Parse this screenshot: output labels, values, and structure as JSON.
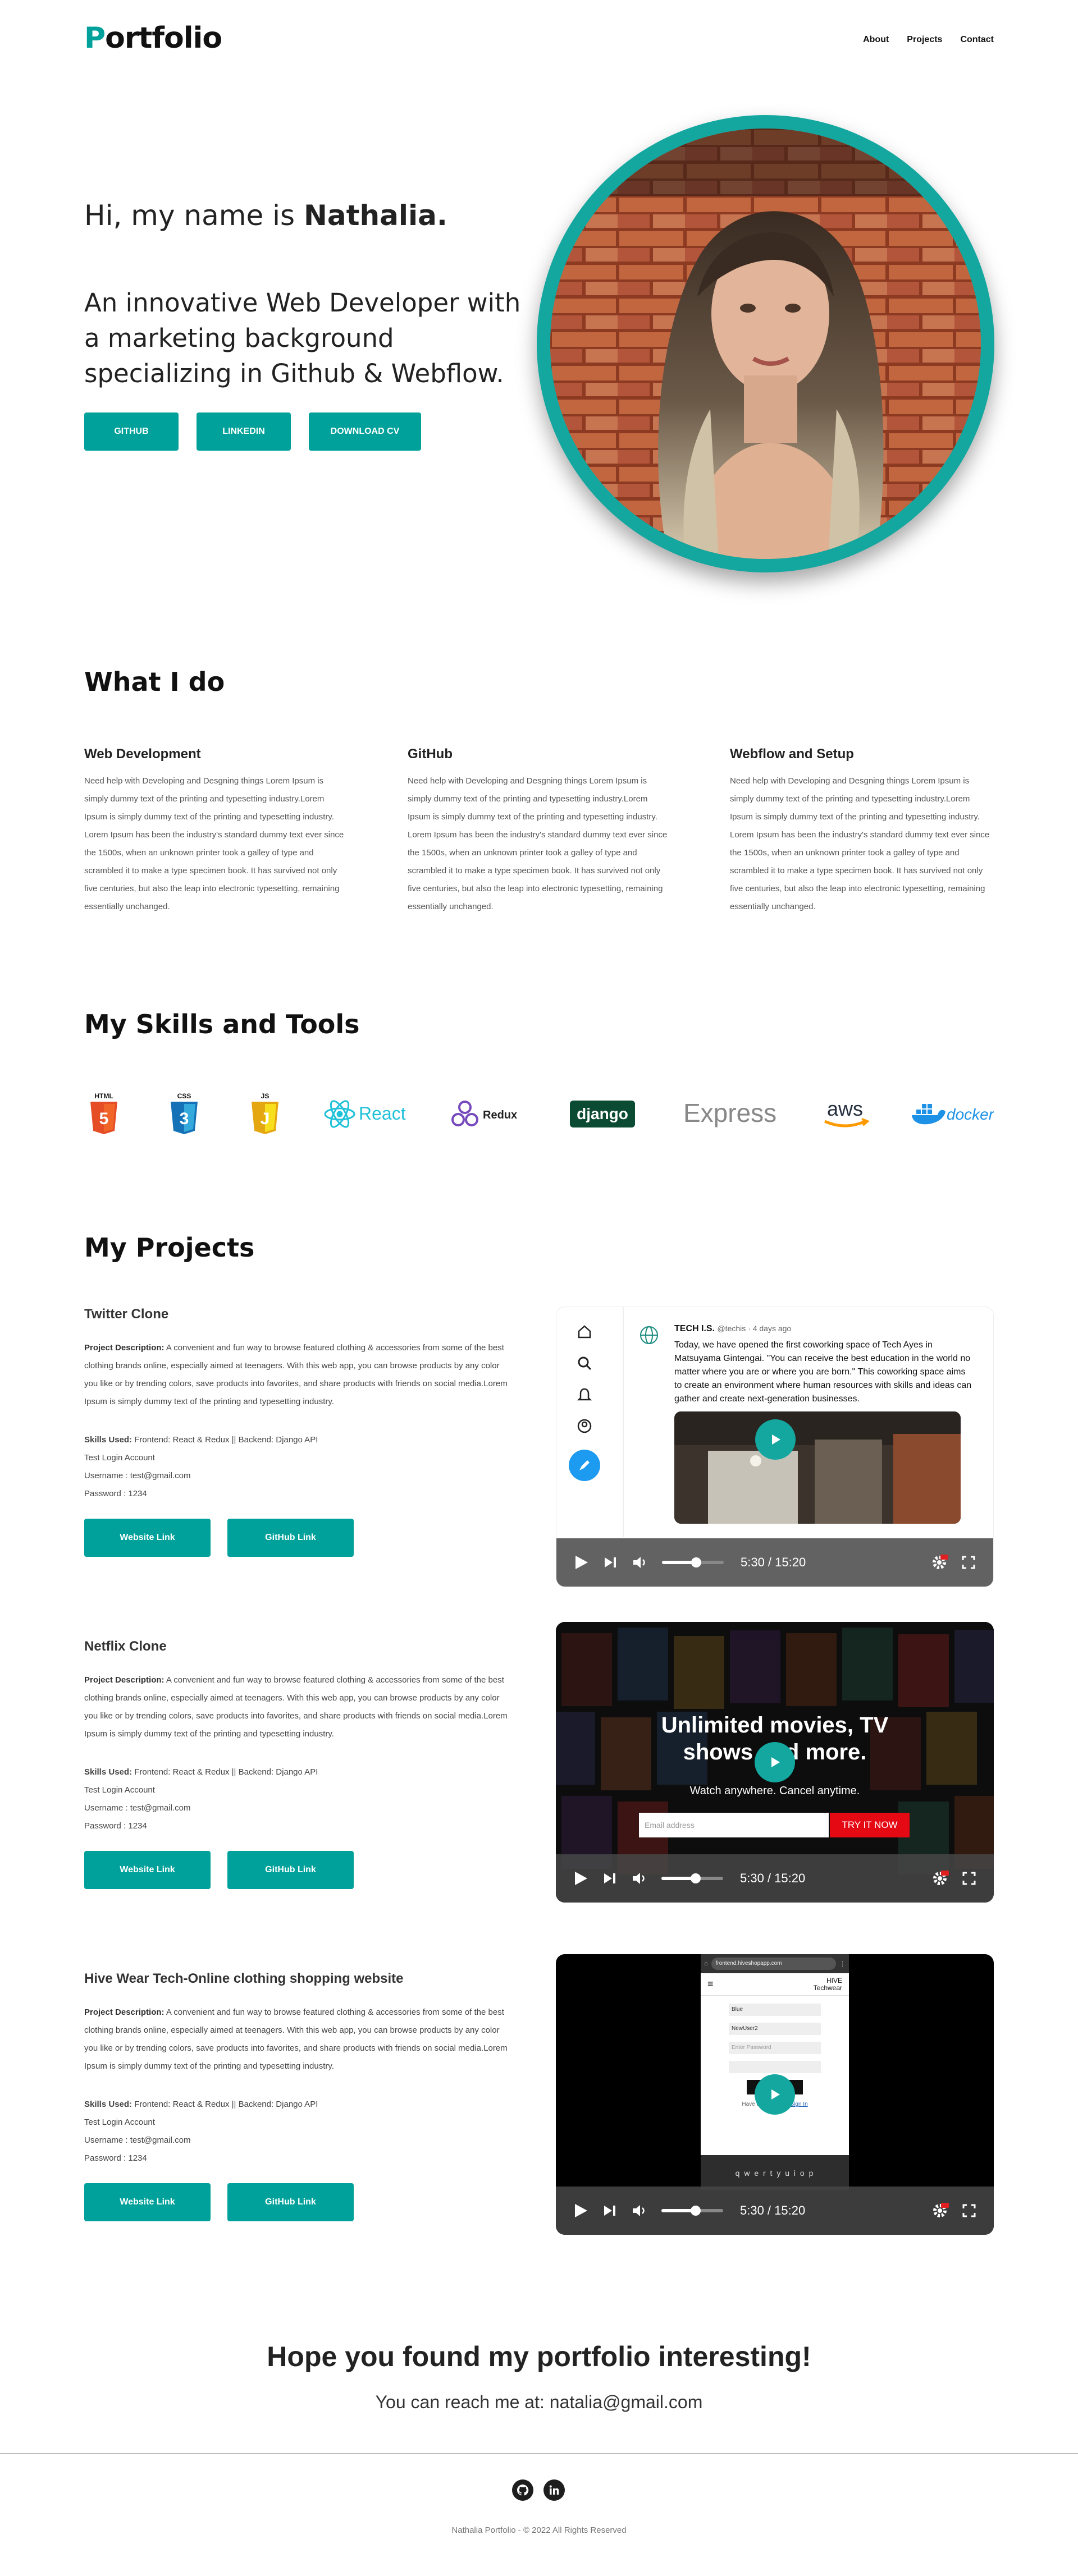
{
  "nav": {
    "logo_first": "P",
    "logo_rest": "ortfolio",
    "links": [
      "About",
      "Projects",
      "Contact"
    ]
  },
  "hero": {
    "greeting": "Hi, my name is",
    "name": "Nathalia.",
    "tagline": "An innovative Web Developer with a marketing background specializing in Github & Webflow.",
    "buttons": [
      "GITHUB",
      "LINKEDIN",
      "DOWNLOAD CV"
    ]
  },
  "what_i_do": {
    "heading": "What I do",
    "services": [
      {
        "title": "Web Development",
        "text": "Need help with Developing and Desgning things Lorem Ipsum is simply dummy text of the printing and typesetting industry.Lorem Ipsum is simply dummy text of the printing and typesetting industry. Lorem Ipsum has been the industry's standard dummy text ever since the 1500s, when an unknown printer took a galley of type and scrambled it to make a type specimen book. It has survived not only five centuries, but also the leap into electronic typesetting, remaining essentially unchanged."
      },
      {
        "title": "GitHub",
        "text": "Need help with Developing and Desgning things Lorem Ipsum is simply dummy text of the printing and typesetting industry.Lorem Ipsum is simply dummy text of the printing and typesetting industry. Lorem Ipsum has been the industry's standard dummy text ever since the 1500s, when an unknown printer took a galley of type and scrambled it to make a type specimen book. It has survived not only five centuries, but also the leap into electronic typesetting, remaining essentially unchanged."
      },
      {
        "title": "Webflow and Setup",
        "text": "Need help with Developing and Desgning things Lorem Ipsum is simply dummy text of the printing and typesetting industry.Lorem Ipsum is simply dummy text of the printing and typesetting industry. Lorem Ipsum has been the industry's standard dummy text ever since the 1500s, when an unknown printer took a galley of type and scrambled it to make a type specimen book. It has survived not only five centuries, but also the leap into electronic typesetting, remaining essentially unchanged."
      }
    ]
  },
  "skills": {
    "heading": "My Skills and Tools",
    "logos": [
      "HTML",
      "CSS",
      "JS",
      "React",
      "Redux",
      "django",
      "Express",
      "aws",
      "docker"
    ]
  },
  "projects": {
    "heading": "My Projects",
    "desc_label": "Project Description:",
    "desc_text": "A convenient and fun way to browse featured clothing & accessories from some of the best clothing brands online, especially aimed at teenagers. With this web app, you can browse products by any color you like or by trending colors, save products into favorites, and share products with friends on social media.Lorem Ipsum is simply dummy text of the printing and typesetting industry.",
    "skills_label": "Skills Used:",
    "skills_text": "Frontend: React & Redux || Backend: Django API",
    "login_label": "Test Login Account",
    "username": "Username : test@gmail.com",
    "password": "Password : 1234",
    "website_btn": "Website Link",
    "github_btn": "GitHub Link",
    "video_time": "5:30 / 15:20",
    "items": [
      {
        "title": "Twitter Clone"
      },
      {
        "title": "Netflix Clone"
      },
      {
        "title": "Hive Wear Tech-Online clothing shopping website"
      }
    ],
    "twitter_preview": {
      "account": "TECH I.S.",
      "handle": "@techis · 4 days ago",
      "text": "Today, we have opened the first coworking space of Tech Ayes in Matsuyama Gintengai. \"You can receive the best education in the world no matter where you are or where you are born.\" This coworking space aims to create an environment where human resources with skills and ideas can gather and create next-generation businesses."
    },
    "netflix_preview": {
      "headline": "Unlimited movies, TV shows and more.",
      "sub": "Watch anywhere. Cancel anytime.",
      "email_placeholder": "Email address",
      "cta": "TRY IT NOW"
    },
    "hive_preview": {
      "url": "frontend.hiveshopapp.com",
      "brand_top": "HIVE",
      "brand_bottom": "Techwear",
      "field1": "Blue",
      "field2": "NewUser2",
      "field3": "Enter Password",
      "signup": "SIGN UP",
      "login_prompt": "Have an account ?",
      "login_link": "Sign In",
      "keyboard_row": "q w e r t y u i o p"
    }
  },
  "contact": {
    "closing": "Hope you found my portfolio interesting!",
    "reach": "You can reach me at: natalia@gmail.com"
  },
  "footer": {
    "copyright": "Nathalia Portfolio - © 2022 All Rights Reserved"
  },
  "colors": {
    "accent": "#00a19a",
    "text": "#111111"
  }
}
